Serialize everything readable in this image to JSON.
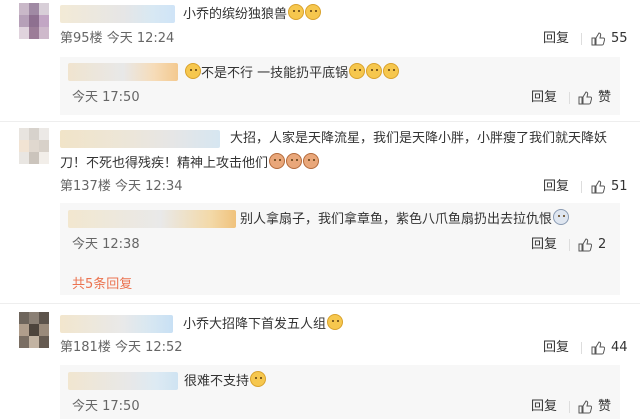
{
  "actions": {
    "reply": "回复",
    "like": "赞"
  },
  "comments": [
    {
      "text": "小乔的缤纷独狼兽",
      "emoji_count": 2,
      "floor": "第95楼",
      "time": "今天 12:24",
      "likes": "55",
      "sub_replies": [
        {
          "text_a": "不是不行 一技能扔平底锅",
          "time": "今天 17:50",
          "likes": "赞"
        }
      ]
    },
    {
      "text_line1": "大招，人家是天降流星，我们是天降小胖，小胖瘦了我们就天降妖",
      "text_line2": "刀！不死也得残疾！精神上攻击他们",
      "floor": "第137楼",
      "time": "今天 12:34",
      "likes": "51",
      "sub_replies": [
        {
          "text": "别人拿扇子，我们拿章鱼，紫色八爪鱼扇扔出去拉仇恨",
          "time": "今天 12:38",
          "likes": "2"
        }
      ],
      "more_replies": "共5条回复"
    },
    {
      "text": "小乔大招降下首发五人组",
      "floor": "第181楼",
      "time": "今天 12:52",
      "likes": "44",
      "sub_replies": [
        {
          "text": "很难不支持",
          "time": "今天 17:50",
          "likes": "赞"
        }
      ]
    }
  ],
  "icons": {
    "like": "thumbs-up-icon",
    "emoji": "cat-face-emoji-icon"
  },
  "colors": {
    "link": "#eb7350",
    "sub_bg": "#f7f7f7"
  }
}
